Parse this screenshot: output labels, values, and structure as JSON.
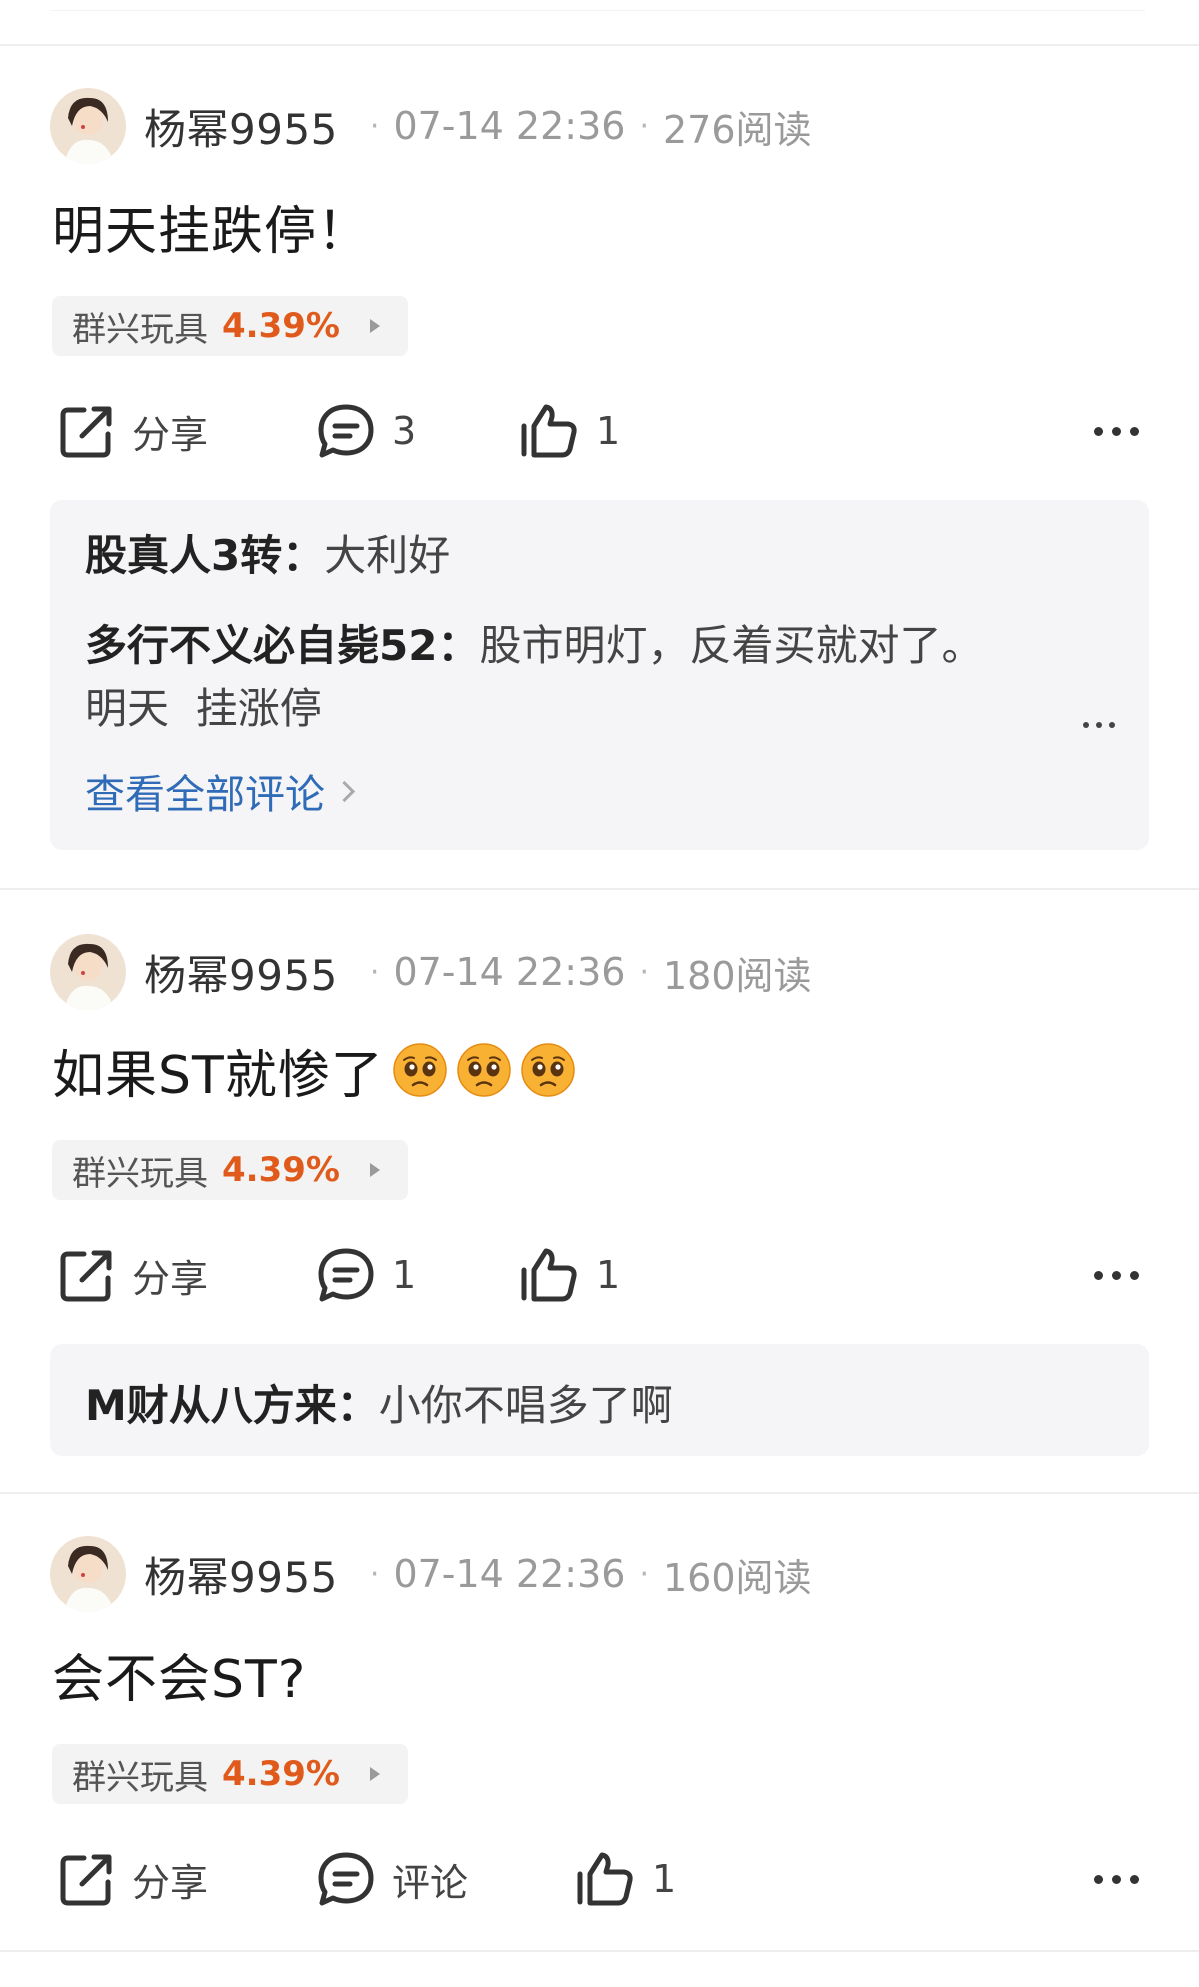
{
  "posts": [
    {
      "username": "杨幂9955",
      "date": "07-14 22:36",
      "reads": "276阅读",
      "content": "明天挂跌停！",
      "emoji_count": 0,
      "stock_name": "群兴玩具",
      "stock_change": "4.39%",
      "share_label": "分享",
      "comment_label": "3",
      "like_count": "1",
      "comments": [
        {
          "author": "股真人3转：",
          "text": "大利好"
        },
        {
          "author": "多行不义必自毙52：",
          "text": "股市明灯，反着买就对了。",
          "text2": "明天  挂涨停"
        }
      ],
      "view_all": "查看全部评论"
    },
    {
      "username": "杨幂9955",
      "date": "07-14 22:36",
      "reads": "180阅读",
      "content": "如果ST就惨了",
      "emoji_count": 3,
      "stock_name": "群兴玩具",
      "stock_change": "4.39%",
      "share_label": "分享",
      "comment_label": "1",
      "like_count": "1",
      "comments": [
        {
          "author": "M财从八方来：",
          "text": "小你不唱多了啊"
        }
      ]
    },
    {
      "username": "杨幂9955",
      "date": "07-14 22:36",
      "reads": "160阅读",
      "content": "会不会ST?",
      "emoji_count": 0,
      "stock_name": "群兴玩具",
      "stock_change": "4.39%",
      "share_label": "分享",
      "comment_label": "评论",
      "like_count": "1"
    }
  ],
  "colors": {
    "accent_red": "#e05b1b",
    "link_blue": "#2f6bb6"
  },
  "icons": [
    "share-icon",
    "comment-icon",
    "like-icon",
    "more-icon",
    "pleading-face-emoji"
  ]
}
